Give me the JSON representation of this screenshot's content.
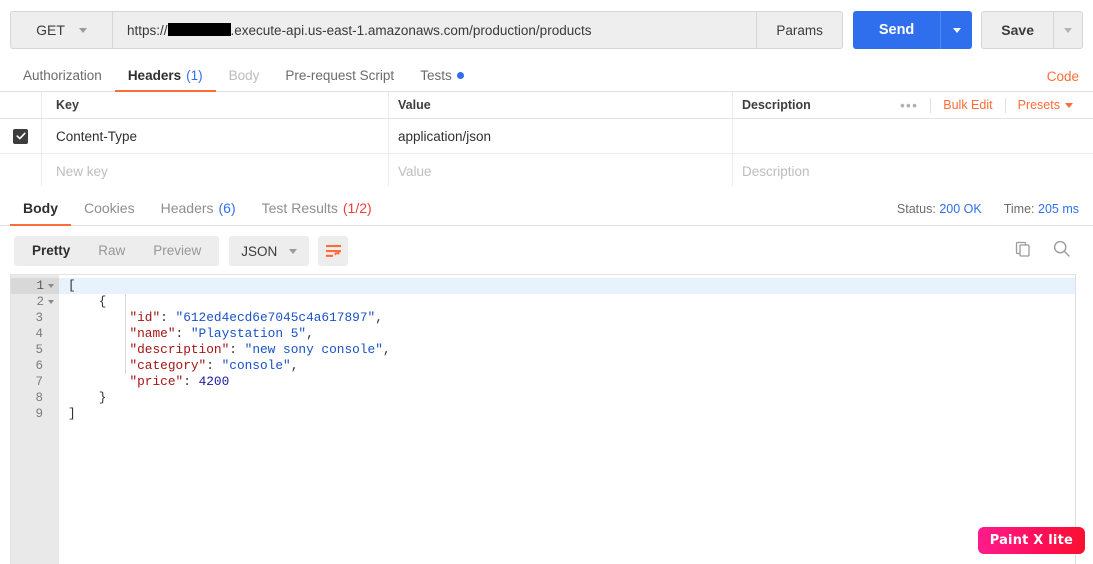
{
  "request": {
    "method": "GET",
    "url_prefix": "https://",
    "url_redacted": true,
    "url_suffix": ".execute-api.us-east-1.amazonaws.com/production/products",
    "params_label": "Params",
    "send_label": "Send",
    "save_label": "Save",
    "accent_color": "#ff6c37",
    "send_color": "#2f6fed"
  },
  "request_tabs": [
    {
      "label": "Authorization",
      "count": "",
      "state": "normal"
    },
    {
      "label": "Headers",
      "count": "(1)",
      "state": "active"
    },
    {
      "label": "Body",
      "count": "",
      "state": "disabled"
    },
    {
      "label": "Pre-request Script",
      "count": "",
      "state": "normal"
    },
    {
      "label": "Tests",
      "count": "",
      "state": "normal",
      "dot": true
    }
  ],
  "code_link": "Code",
  "headers_table": {
    "columns": [
      "Key",
      "Value",
      "Description"
    ],
    "actions": {
      "more": "•••",
      "bulk_edit": "Bulk Edit",
      "presets": "Presets"
    },
    "rows": [
      {
        "checked": true,
        "key": "Content-Type",
        "value": "application/json",
        "description": ""
      }
    ],
    "placeholder_row": {
      "key": "New key",
      "value": "Value",
      "description": "Description"
    }
  },
  "response_tabs": [
    {
      "label": "Body",
      "count": "",
      "state": "active"
    },
    {
      "label": "Cookies",
      "count": "",
      "state": "normal"
    },
    {
      "label": "Headers",
      "count": "(6)",
      "count_color": "blue",
      "state": "normal"
    },
    {
      "label": "Test Results",
      "count": "(1/2)",
      "count_color": "red",
      "state": "normal"
    }
  ],
  "response_meta": {
    "status_label": "Status:",
    "status_value": "200 OK",
    "time_label": "Time:",
    "time_value": "205 ms"
  },
  "format_bar": {
    "modes": [
      "Pretty",
      "Raw",
      "Preview"
    ],
    "active_mode": "Pretty",
    "language": "JSON",
    "wrap_icon": "word-wrap-icon",
    "copy_icon": "copy-icon",
    "search_icon": "search-icon"
  },
  "body": {
    "lines": [
      {
        "num": "1",
        "fold": true,
        "highlight": true,
        "indent": 0,
        "tokens": [
          {
            "t": "[",
            "c": "p"
          }
        ]
      },
      {
        "num": "2",
        "fold": true,
        "highlight": false,
        "indent": 1,
        "tokens": [
          {
            "t": "{",
            "c": "p"
          }
        ]
      },
      {
        "num": "3",
        "fold": false,
        "highlight": false,
        "indent": 2,
        "tokens": [
          {
            "t": "\"id\"",
            "c": "k"
          },
          {
            "t": ": ",
            "c": "p"
          },
          {
            "t": "\"612ed4ecd6e7045c4a617897\"",
            "c": "s"
          },
          {
            "t": ",",
            "c": "p"
          }
        ]
      },
      {
        "num": "4",
        "fold": false,
        "highlight": false,
        "indent": 2,
        "tokens": [
          {
            "t": "\"name\"",
            "c": "k"
          },
          {
            "t": ": ",
            "c": "p"
          },
          {
            "t": "\"Playstation 5\"",
            "c": "s"
          },
          {
            "t": ",",
            "c": "p"
          }
        ]
      },
      {
        "num": "5",
        "fold": false,
        "highlight": false,
        "indent": 2,
        "tokens": [
          {
            "t": "\"description\"",
            "c": "k"
          },
          {
            "t": ": ",
            "c": "p"
          },
          {
            "t": "\"new sony console\"",
            "c": "s"
          },
          {
            "t": ",",
            "c": "p"
          }
        ]
      },
      {
        "num": "6",
        "fold": false,
        "highlight": false,
        "indent": 2,
        "tokens": [
          {
            "t": "\"category\"",
            "c": "k"
          },
          {
            "t": ": ",
            "c": "p"
          },
          {
            "t": "\"console\"",
            "c": "s"
          },
          {
            "t": ",",
            "c": "p"
          }
        ]
      },
      {
        "num": "7",
        "fold": false,
        "highlight": false,
        "indent": 2,
        "tokens": [
          {
            "t": "\"price\"",
            "c": "k"
          },
          {
            "t": ": ",
            "c": "p"
          },
          {
            "t": "4200",
            "c": "n"
          }
        ]
      },
      {
        "num": "8",
        "fold": false,
        "highlight": false,
        "indent": 1,
        "tokens": [
          {
            "t": "}",
            "c": "p"
          }
        ]
      },
      {
        "num": "9",
        "fold": false,
        "highlight": false,
        "indent": 0,
        "tokens": [
          {
            "t": "]",
            "c": "p"
          }
        ]
      }
    ]
  },
  "watermark": {
    "text": "Paint X lite"
  }
}
